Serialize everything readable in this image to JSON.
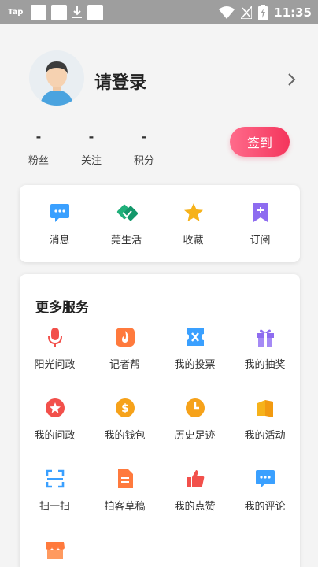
{
  "status_bar": {
    "tap": "Tap",
    "time": "11:35"
  },
  "profile": {
    "login_text": "请登录",
    "stats": [
      {
        "value": "-",
        "label": "粉丝"
      },
      {
        "value": "-",
        "label": "关注"
      },
      {
        "value": "-",
        "label": "积分"
      }
    ],
    "checkin_label": "签到"
  },
  "quick_actions": [
    {
      "label": "消息",
      "icon": "message-icon"
    },
    {
      "label": "莞生活",
      "icon": "handshake-icon"
    },
    {
      "label": "收藏",
      "icon": "star-icon"
    },
    {
      "label": "订阅",
      "icon": "bookmark-plus-icon"
    }
  ],
  "services": {
    "title": "更多服务",
    "items": [
      {
        "label": "阳光问政",
        "icon": "microphone-icon"
      },
      {
        "label": "记者帮",
        "icon": "fire-icon"
      },
      {
        "label": "我的投票",
        "icon": "vote-icon"
      },
      {
        "label": "我的抽奖",
        "icon": "gift-icon"
      },
      {
        "label": "我的问政",
        "icon": "star-badge-icon"
      },
      {
        "label": "我的钱包",
        "icon": "wallet-icon"
      },
      {
        "label": "历史足迹",
        "icon": "clock-icon"
      },
      {
        "label": "我的活动",
        "icon": "flag-icon"
      },
      {
        "label": "扫一扫",
        "icon": "scan-icon"
      },
      {
        "label": "拍客草稿",
        "icon": "document-icon"
      },
      {
        "label": "我的点赞",
        "icon": "thumbs-up-icon"
      },
      {
        "label": "我的评论",
        "icon": "comment-icon"
      },
      {
        "label": "",
        "icon": "store-icon"
      }
    ]
  },
  "colors": {
    "accent": "#f4355c",
    "blue": "#3aa0ff",
    "orange": "#ff8a3d",
    "red": "#f2504b",
    "purple": "#8e6cf0"
  }
}
